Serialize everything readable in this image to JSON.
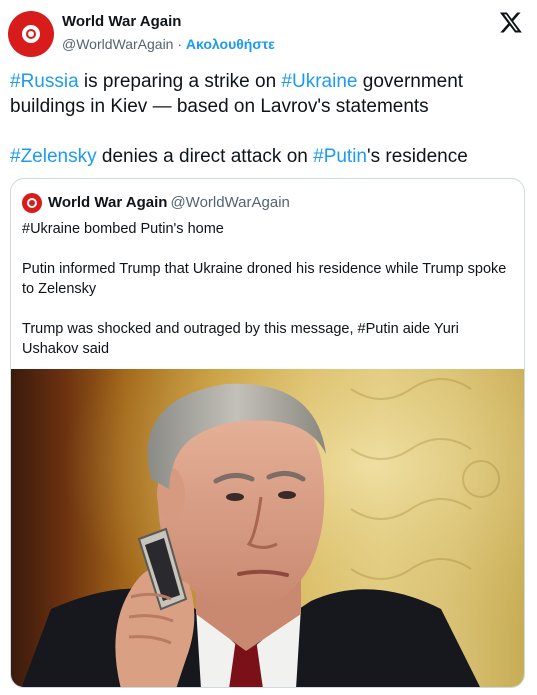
{
  "tweet": {
    "author_name": "World War Again",
    "author_handle": "@WorldWarAgain",
    "separator": " · ",
    "follow_label": "Ακολουθήστε",
    "paragraph1": {
      "tag1": "#Russia",
      "text1": " is preparing a strike on ",
      "tag2": "#Ukraine",
      "text2": " government buildings in Kiev — based on Lavrov's statements"
    },
    "paragraph2": {
      "tag1": "#Zelensky",
      "text1": " denies a direct attack on ",
      "tag2": "#Putin",
      "text2": "'s residence"
    }
  },
  "quoted": {
    "author_name": "World War Again",
    "author_handle": "@WorldWarAgain",
    "line1": "#Ukraine bombed Putin's home",
    "line2": "Putin informed Trump that Ukraine droned his residence while Trump spoke to Zelensky",
    "line3": "Trump was shocked and outraged by this message, #Putin aide Yuri Ushakov said"
  },
  "icons": {
    "x_logo": "x-logo-icon",
    "avatar": "avatar-icon"
  },
  "colors": {
    "accent": "#1d9bf0",
    "avatar_red": "#d81c1c",
    "secondary_text": "#536471"
  }
}
